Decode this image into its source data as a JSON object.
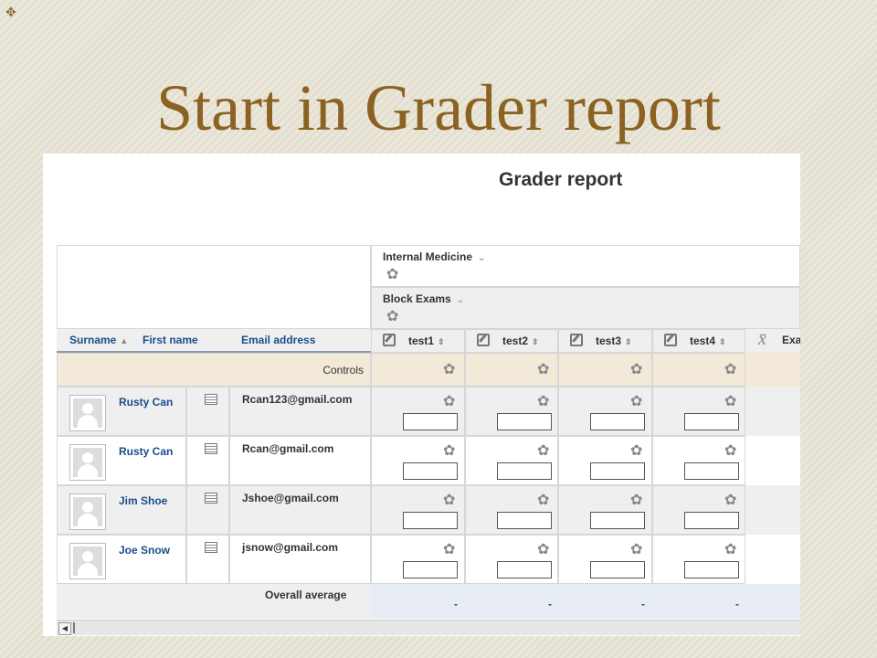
{
  "slide": {
    "title": "Start in Grader report"
  },
  "report": {
    "heading": "Grader report",
    "categories": [
      {
        "label": "Internal Medicine"
      },
      {
        "label": "Block Exams"
      }
    ],
    "sort_surname": "Surname",
    "sort_firstname": "First name",
    "email_header": "Email address",
    "tests": [
      "test1",
      "test2",
      "test3",
      "test4"
    ],
    "total_label": "Exa",
    "controls_label": "Controls",
    "students": [
      {
        "name": "Rusty Can",
        "email": "Rcan123@gmail.com"
      },
      {
        "name": "Rusty Can",
        "email": "Rcan@gmail.com"
      },
      {
        "name": "Jim Shoe",
        "email": "Jshoe@gmail.com"
      },
      {
        "name": "Joe Snow",
        "email": "jsnow@gmail.com"
      }
    ],
    "overall_label": "Overall average",
    "overall_values": [
      "-",
      "-",
      "-",
      "-"
    ]
  },
  "colors": {
    "title": "#8b6222",
    "link": "#1a4e8a",
    "controls_row": "#f2e9d9"
  },
  "icons": {
    "gear": "gear-icon",
    "edit": "edit-icon",
    "avatar": "user-avatar-icon",
    "report": "user-report-icon",
    "mean": "mean-icon"
  }
}
